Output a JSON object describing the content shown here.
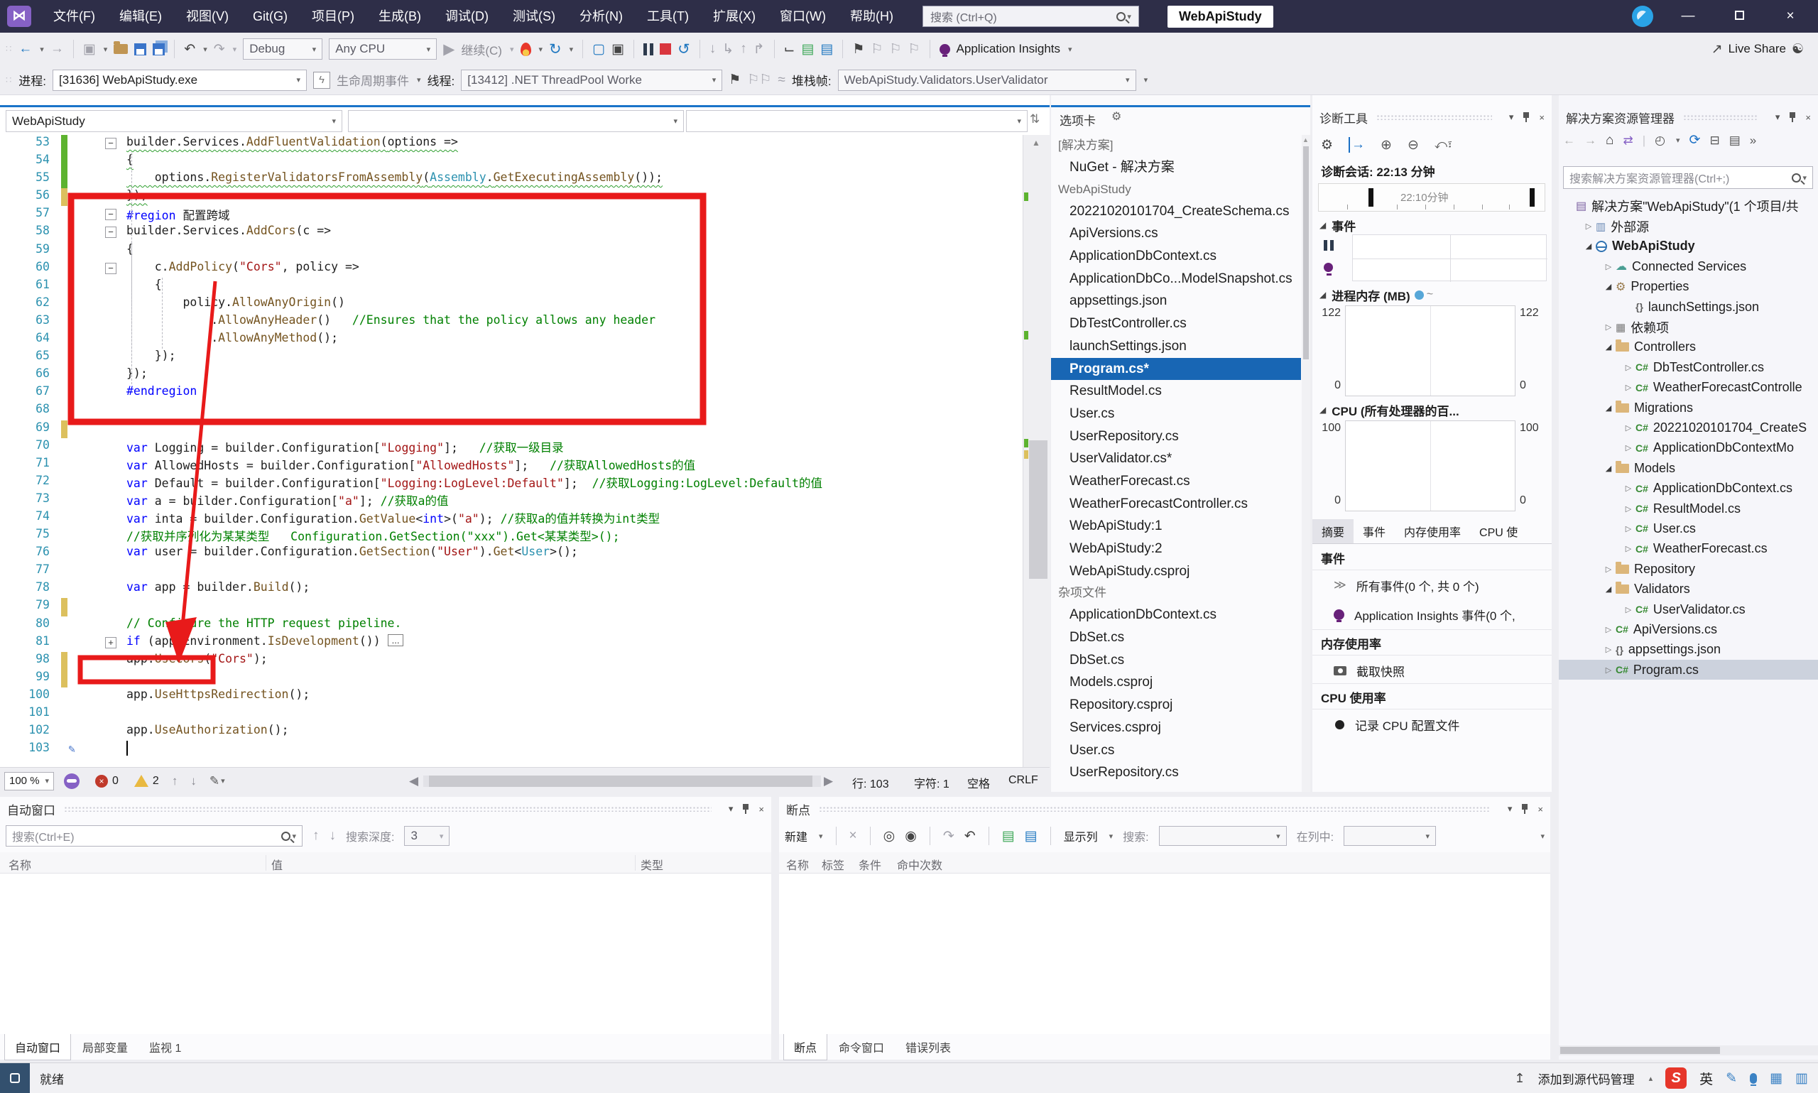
{
  "colors": {
    "titlebar_bg": "#2e2e48",
    "accent_blue": "#1a74c9",
    "selection_blue": "#1866b4",
    "annotation_red": "#e81a1a",
    "error_red": "#c0392b",
    "warning_yellow": "#e9b940"
  },
  "title_bar": {
    "menus": [
      "文件(F)",
      "编辑(E)",
      "视图(V)",
      "Git(G)",
      "项目(P)",
      "生成(B)",
      "调试(D)",
      "测试(S)",
      "分析(N)",
      "工具(T)",
      "扩展(X)",
      "窗口(W)",
      "帮助(H)"
    ],
    "search_placeholder": "搜索 (Ctrl+Q)",
    "window_title": "WebApiStudy"
  },
  "toolbar": {
    "debug_config": "Debug",
    "platform": "Any CPU",
    "continue_label": "继续(C)",
    "app_insights_label": "Application Insights",
    "live_share_label": "Live Share"
  },
  "debug_toolbar": {
    "process_label": "进程:",
    "process_value": "[31636] WebApiStudy.exe",
    "lifecycle_label": "生命周期事件",
    "thread_label": "线程:",
    "thread_value": "[13412] .NET ThreadPool Worke",
    "frame_label": "堆栈帧:",
    "frame_value": "WebApiStudy.Validators.UserValidator"
  },
  "editor": {
    "nav_project": "WebApiStudy",
    "collapsed_box": "...",
    "zoom": "100 %",
    "error_count": "0",
    "warning_count": "2",
    "line_info": "行: 103",
    "char_info": "字符: 1",
    "space_info": "空格",
    "eol_info": "CRLF",
    "lines": [
      {
        "n": 53,
        "g": "g",
        "f": "-",
        "sq": 1,
        "segs": [
          [
            "builder.Services.",
            ""
          ],
          [
            "AddFluentValidation",
            "m"
          ],
          [
            "(",
            ""
          ],
          [
            "options",
            ""
          ],
          [
            " =>",
            ""
          ]
        ]
      },
      {
        "n": 54,
        "g": "g",
        "sq": 1,
        "segs": [
          [
            "{",
            ""
          ]
        ]
      },
      {
        "n": 55,
        "g": "g",
        "sq": 1,
        "segs": [
          [
            "    options.",
            ""
          ],
          [
            "RegisterValidatorsFromAssembly",
            "m"
          ],
          [
            "(",
            ""
          ],
          [
            "Assembly",
            "t"
          ],
          [
            ".",
            ""
          ],
          [
            "GetExecutingAssembly",
            "m"
          ],
          [
            "());",
            ""
          ]
        ]
      },
      {
        "n": 56,
        "g": "y",
        "sq": 1,
        "segs": [
          [
            "});",
            ""
          ]
        ]
      },
      {
        "n": 57,
        "f": "-",
        "segs": [
          [
            "#region",
            "k"
          ],
          [
            " 配置跨域",
            ""
          ]
        ]
      },
      {
        "n": 58,
        "f": "-",
        "segs": [
          [
            "builder.Services.",
            ""
          ],
          [
            "AddCors",
            "m"
          ],
          [
            "(c =>",
            ""
          ]
        ]
      },
      {
        "n": 59,
        "segs": [
          [
            "{",
            ""
          ]
        ]
      },
      {
        "n": 60,
        "f": "-",
        "segs": [
          [
            "    c.",
            ""
          ],
          [
            "AddPolicy",
            "m"
          ],
          [
            "(",
            ""
          ],
          [
            "\"Cors\"",
            "s"
          ],
          [
            ", policy =>",
            ""
          ]
        ]
      },
      {
        "n": 61,
        "segs": [
          [
            "    {",
            ""
          ]
        ]
      },
      {
        "n": 62,
        "segs": [
          [
            "        policy.",
            ""
          ],
          [
            "AllowAnyOrigin",
            "m"
          ],
          [
            "()",
            ""
          ]
        ]
      },
      {
        "n": 63,
        "segs": [
          [
            "            .",
            ""
          ],
          [
            "AllowAnyHeader",
            "m"
          ],
          [
            "()   ",
            ""
          ],
          [
            "//Ensures that the policy allows any header",
            "c"
          ]
        ]
      },
      {
        "n": 64,
        "segs": [
          [
            "            .",
            ""
          ],
          [
            "AllowAnyMethod",
            "m"
          ],
          [
            "();",
            ""
          ]
        ]
      },
      {
        "n": 65,
        "segs": [
          [
            "    });",
            ""
          ]
        ]
      },
      {
        "n": 66,
        "segs": [
          [
            "});",
            ""
          ]
        ]
      },
      {
        "n": 67,
        "segs": [
          [
            "#endregion",
            "k"
          ]
        ]
      },
      {
        "n": 68,
        "segs": []
      },
      {
        "n": 69,
        "g": "y",
        "segs": []
      },
      {
        "n": 70,
        "segs": [
          [
            "var",
            "k"
          ],
          [
            " Logging = builder.Configuration[",
            ""
          ],
          [
            "\"Logging\"",
            "s"
          ],
          [
            "];   ",
            ""
          ],
          [
            "//获取一级目录",
            "c"
          ]
        ]
      },
      {
        "n": 71,
        "segs": [
          [
            "var",
            "k"
          ],
          [
            " AllowedHosts = builder.Configuration[",
            ""
          ],
          [
            "\"AllowedHosts\"",
            "s"
          ],
          [
            "];   ",
            ""
          ],
          [
            "//获取AllowedHosts的值",
            "c"
          ]
        ]
      },
      {
        "n": 72,
        "segs": [
          [
            "var",
            "k"
          ],
          [
            " Default = builder.Configuration[",
            ""
          ],
          [
            "\"Logging:LogLevel:Default\"",
            "s"
          ],
          [
            "];  ",
            ""
          ],
          [
            "//获取Logging:LogLevel:Default的值",
            "c"
          ]
        ]
      },
      {
        "n": 73,
        "segs": [
          [
            "var",
            "k"
          ],
          [
            " a = builder.Configuration[",
            ""
          ],
          [
            "\"a\"",
            "s"
          ],
          [
            "]; ",
            ""
          ],
          [
            "//获取a的值",
            "c"
          ]
        ]
      },
      {
        "n": 74,
        "segs": [
          [
            "var",
            "k"
          ],
          [
            " inta = builder.Configuration.",
            ""
          ],
          [
            "GetValue",
            "m"
          ],
          [
            "<",
            ""
          ],
          [
            "int",
            "k"
          ],
          [
            ">(",
            ""
          ],
          [
            "\"a\"",
            "s"
          ],
          [
            "); ",
            ""
          ],
          [
            "//获取a的值并转换为int类型",
            "c"
          ]
        ]
      },
      {
        "n": 75,
        "segs": [
          [
            "//获取并序列化为某某类型   Configuration.GetSection(\"xxx\").Get<某某类型>();",
            "c"
          ]
        ]
      },
      {
        "n": 76,
        "segs": [
          [
            "var",
            "k"
          ],
          [
            " user = builder.Configuration.",
            ""
          ],
          [
            "GetSection",
            "m"
          ],
          [
            "(",
            ""
          ],
          [
            "\"User\"",
            "s"
          ],
          [
            ").",
            ""
          ],
          [
            "Get",
            "m"
          ],
          [
            "<",
            ""
          ],
          [
            "User",
            "t"
          ],
          [
            ">();",
            ""
          ]
        ]
      },
      {
        "n": 77,
        "segs": []
      },
      {
        "n": 78,
        "segs": [
          [
            "var",
            "k"
          ],
          [
            " app = builder.",
            ""
          ],
          [
            "Build",
            "m"
          ],
          [
            "();",
            ""
          ]
        ]
      },
      {
        "n": 79,
        "g": "y",
        "segs": []
      },
      {
        "n": 80,
        "segs": [
          [
            "// Configure the HTTP request pipeline.",
            "c"
          ]
        ]
      },
      {
        "n": 81,
        "f": "+",
        "collapsed": 1,
        "segs": [
          [
            "if",
            "k"
          ],
          [
            " (app.Environment.",
            ""
          ],
          [
            "IsDevelopment",
            "m"
          ],
          [
            "())",
            ""
          ]
        ]
      },
      {
        "n": 98,
        "g": "y",
        "segs": [
          [
            "app.",
            ""
          ],
          [
            "UseCors",
            "m"
          ],
          [
            "(",
            ""
          ],
          [
            "\"Cors\"",
            "s"
          ],
          [
            ");",
            ""
          ]
        ]
      },
      {
        "n": 99,
        "g": "y",
        "segs": []
      },
      {
        "n": 100,
        "segs": [
          [
            "app.",
            ""
          ],
          [
            "UseHttpsRedirection",
            "m"
          ],
          [
            "();",
            ""
          ]
        ]
      },
      {
        "n": 101,
        "segs": []
      },
      {
        "n": 102,
        "segs": [
          [
            "app.",
            ""
          ],
          [
            "UseAuthorization",
            "m"
          ],
          [
            "();",
            ""
          ]
        ]
      },
      {
        "n": 103,
        "cursor": 1,
        "tool": 1,
        "segs": []
      }
    ]
  },
  "tabs_panel": {
    "title": "选项卡",
    "groups": [
      {
        "header": "[解决方案]",
        "items": [
          {
            "label": "NuGet - 解决方案"
          }
        ]
      },
      {
        "header": "WebApiStudy",
        "items": [
          {
            "label": "20221020101704_CreateSchema.cs"
          },
          {
            "label": "ApiVersions.cs"
          },
          {
            "label": "ApplicationDbContext.cs"
          },
          {
            "label": "ApplicationDbCo...ModelSnapshot.cs"
          },
          {
            "label": "appsettings.json"
          },
          {
            "label": "DbTestController.cs"
          },
          {
            "label": "launchSettings.json"
          },
          {
            "label": "Program.cs*",
            "selected": true
          },
          {
            "label": "ResultModel.cs"
          },
          {
            "label": "User.cs"
          },
          {
            "label": "UserRepository.cs"
          },
          {
            "label": "UserValidator.cs*"
          },
          {
            "label": "WeatherForecast.cs"
          },
          {
            "label": "WeatherForecastController.cs"
          },
          {
            "label": "WebApiStudy:1"
          },
          {
            "label": "WebApiStudy:2"
          },
          {
            "label": "WebApiStudy.csproj"
          }
        ]
      },
      {
        "header": "杂项文件",
        "items": [
          {
            "label": "ApplicationDbContext.cs"
          },
          {
            "label": "DbSet.cs"
          },
          {
            "label": "DbSet.cs"
          },
          {
            "label": "Models.csproj"
          },
          {
            "label": "Repository.csproj"
          },
          {
            "label": "Services.csproj"
          },
          {
            "label": "User.cs"
          },
          {
            "label": "UserRepository.cs"
          }
        ]
      }
    ]
  },
  "diagnostics": {
    "title": "诊断工具",
    "session": "诊断会话: 22:13 分钟",
    "timeline_label": "22:10分钟",
    "events_section": "事件",
    "memory_section": "进程内存 (MB)",
    "memory_max": "122",
    "memory_min": "0",
    "cpu_section": "CPU (所有处理器的百...",
    "cpu_max": "100",
    "cpu_min": "0",
    "tabs": [
      "摘要",
      "事件",
      "内存使用率",
      "CPU 使"
    ],
    "summary": {
      "events_header": "事件",
      "all_events": "所有事件(0 个, 共 0 个)",
      "ai_events": "Application Insights 事件(0 个,",
      "memory_header": "内存使用率",
      "snapshot": "截取快照",
      "cpu_header": "CPU 使用率",
      "record_cpu": "记录 CPU 配置文件"
    }
  },
  "solution_explorer": {
    "title": "解决方案资源管理器",
    "search_placeholder": "搜索解决方案资源管理器(Ctrl+;)",
    "tree": [
      {
        "lvl": 0,
        "exp": "",
        "icon": "sln",
        "label": "解决方案\"WebApiStudy\"(1 个项目/共"
      },
      {
        "lvl": 1,
        "exp": "c",
        "icon": "ext",
        "label": "外部源"
      },
      {
        "lvl": 1,
        "exp": "o",
        "icon": "globe",
        "label": "WebApiStudy",
        "bold": true
      },
      {
        "lvl": 2,
        "exp": "c",
        "icon": "cloud",
        "label": "Connected Services"
      },
      {
        "lvl": 2,
        "exp": "o",
        "icon": "wrench",
        "label": "Properties"
      },
      {
        "lvl": 3,
        "exp": "",
        "icon": "json",
        "label": "launchSettings.json"
      },
      {
        "lvl": 2,
        "exp": "c",
        "icon": "deps",
        "label": "依赖项"
      },
      {
        "lvl": 2,
        "exp": "o",
        "icon": "folder",
        "label": "Controllers"
      },
      {
        "lvl": 3,
        "exp": "c",
        "icon": "cs",
        "label": "DbTestController.cs"
      },
      {
        "lvl": 3,
        "exp": "c",
        "icon": "cs",
        "label": "WeatherForecastControlle"
      },
      {
        "lvl": 2,
        "exp": "o",
        "icon": "folder",
        "label": "Migrations"
      },
      {
        "lvl": 3,
        "exp": "c",
        "icon": "cs",
        "label": "20221020101704_CreateS"
      },
      {
        "lvl": 3,
        "exp": "c",
        "icon": "cs",
        "label": "ApplicationDbContextMo"
      },
      {
        "lvl": 2,
        "exp": "o",
        "icon": "folder",
        "label": "Models"
      },
      {
        "lvl": 3,
        "exp": "c",
        "icon": "cs",
        "label": "ApplicationDbContext.cs"
      },
      {
        "lvl": 3,
        "exp": "c",
        "icon": "cs",
        "label": "ResultModel.cs"
      },
      {
        "lvl": 3,
        "exp": "c",
        "icon": "cs",
        "label": "User.cs"
      },
      {
        "lvl": 3,
        "exp": "c",
        "icon": "cs",
        "label": "WeatherForecast.cs"
      },
      {
        "lvl": 2,
        "exp": "c",
        "icon": "folder",
        "label": "Repository"
      },
      {
        "lvl": 2,
        "exp": "o",
        "icon": "folder",
        "label": "Validators"
      },
      {
        "lvl": 3,
        "exp": "c",
        "icon": "cs",
        "label": "UserValidator.cs"
      },
      {
        "lvl": 2,
        "exp": "c",
        "icon": "cs",
        "label": "ApiVersions.cs"
      },
      {
        "lvl": 2,
        "exp": "c",
        "icon": "json",
        "label": "appsettings.json"
      },
      {
        "lvl": 2,
        "exp": "c",
        "icon": "cs",
        "label": "Program.cs",
        "selected": true
      }
    ]
  },
  "autos_panel": {
    "title": "自动窗口",
    "search_placeholder": "搜索(Ctrl+E)",
    "depth_label": "搜索深度:",
    "depth_value": "3",
    "columns": [
      "名称",
      "值",
      "类型"
    ],
    "tabs": [
      "自动窗口",
      "局部变量",
      "监视 1"
    ]
  },
  "breakpoints_panel": {
    "title": "断点",
    "new_label": "新建",
    "show_columns_label": "显示列",
    "search_label": "搜索:",
    "in_column_label": "在列中:",
    "columns": [
      "名称",
      "标签",
      "条件",
      "命中次数"
    ],
    "tabs": [
      "断点",
      "命令窗口",
      "错误列表"
    ]
  },
  "status_bar": {
    "ready": "就绪",
    "source_control": "添加到源代码管理",
    "ime": "英",
    "ime_logo": "S"
  }
}
